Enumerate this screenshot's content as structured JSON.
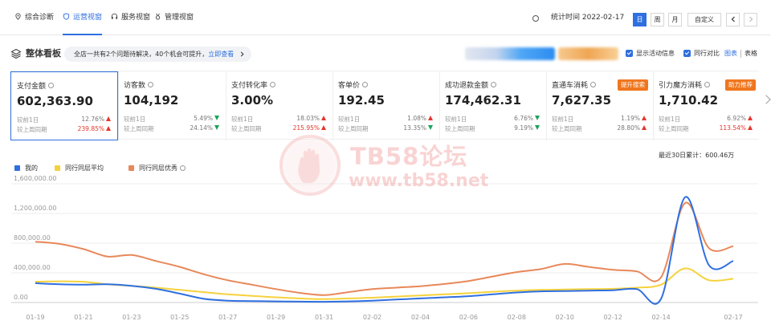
{
  "nav": {
    "tabs": [
      {
        "label": "综合诊断",
        "icon": "location-pin-icon"
      },
      {
        "label": "运营视窗",
        "icon": "shield-icon"
      },
      {
        "label": "服务视窗",
        "icon": "headset-icon"
      },
      {
        "label": "管理视窗",
        "icon": "medal-icon"
      }
    ],
    "active_tab": "运营视窗",
    "stat_time": "统计时间 2022-02-17",
    "period_buttons": [
      "日",
      "周",
      "月",
      "自定义"
    ],
    "active_period": "日",
    "prev_icon": "chevron-left-icon",
    "next_icon": "chevron-right-icon"
  },
  "board": {
    "title": "整体看板",
    "notice_text": "全店一共有2个问题待解决，40个机会可提升，",
    "notice_link": "立即查看",
    "show_activity_label": "显示活动信息",
    "peer_compare_label": "同行对比",
    "view_chart": "图表",
    "view_table": "表格"
  },
  "metrics": [
    {
      "label": "支付金额",
      "value": "602,363.90",
      "row1_label": "较前1日",
      "row1_pct": "12.76%",
      "row1_dir": "up",
      "row2_label": "较上周同期",
      "row2_pct": "239.85%",
      "row2_dir": "up",
      "selected": true
    },
    {
      "label": "访客数",
      "value": "104,192",
      "row1_label": "较前1日",
      "row1_pct": "5.49%",
      "row1_dir": "down",
      "row2_label": "较上周同期",
      "row2_pct": "24.14%",
      "row2_dir": "down"
    },
    {
      "label": "支付转化率",
      "value": "3.00%",
      "row1_label": "较前1日",
      "row1_pct": "18.03%",
      "row1_dir": "up",
      "row2_label": "较上周同期",
      "row2_pct": "215.95%",
      "row2_dir": "up"
    },
    {
      "label": "客单价",
      "value": "192.45",
      "row1_label": "较前1日",
      "row1_pct": "1.08%",
      "row1_dir": "up",
      "row2_label": "较上周同期",
      "row2_pct": "13.35%",
      "row2_dir": "down"
    },
    {
      "label": "成功退款金额",
      "value": "174,462.31",
      "row1_label": "较前1日",
      "row1_pct": "6.76%",
      "row1_dir": "down",
      "row2_label": "较上周同期",
      "row2_pct": "9.19%",
      "row2_dir": "down"
    },
    {
      "label": "直通车消耗",
      "value": "7,627.35",
      "row1_label": "较前1日",
      "row1_pct": "1.19%",
      "row1_dir": "up",
      "row2_label": "较上周同期",
      "row2_pct": "28.80%",
      "row2_dir": "up",
      "tag": "提升搜索"
    },
    {
      "label": "引力魔方消耗",
      "value": "1,710.42",
      "row1_label": "较前1日",
      "row1_pct": "6.92%",
      "row1_dir": "up",
      "row2_label": "较上周同期",
      "row2_pct": "113.54%",
      "row2_dir": "up",
      "tag": "助力推荐"
    }
  ],
  "cumulative_label": "最近30日累计：600.46万",
  "watermark": {
    "line1": "TB58论坛",
    "line2": "www.tb58.net"
  },
  "colors": {
    "accent": "#2f6fe0",
    "mine": "#2f6fe0",
    "peer_avg": "#f5d23c",
    "peer_top": "#e8885a",
    "up": "#e5352b",
    "down": "#1aa35a",
    "tag": "#f0761e"
  },
  "chart_data": {
    "type": "line",
    "ylim": [
      0,
      1600000
    ],
    "y_ticks": [
      "0.00",
      "400,000.00",
      "800,000.00",
      "1,200,000.00",
      "1,600,000.00"
    ],
    "x_tick_labels": [
      "01-19",
      "01-21",
      "01-23",
      "01-25",
      "01-27",
      "01-29",
      "01-31",
      "02-02",
      "02-04",
      "02-06",
      "02-08",
      "02-10",
      "02-12",
      "02-14",
      "02-17"
    ],
    "x_tick_index": [
      0,
      2,
      4,
      6,
      8,
      10,
      12,
      14,
      16,
      18,
      20,
      22,
      24,
      26,
      29
    ],
    "legend_position": "top-left",
    "grid": true,
    "x": [
      "01-19",
      "01-20",
      "01-21",
      "01-22",
      "01-23",
      "01-24",
      "01-25",
      "01-26",
      "01-27",
      "01-28",
      "01-29",
      "01-30",
      "01-31",
      "02-01",
      "02-02",
      "02-03",
      "02-04",
      "02-05",
      "02-06",
      "02-07",
      "02-08",
      "02-09",
      "02-10",
      "02-11",
      "02-12",
      "02-13",
      "02-14",
      "02-15",
      "02-16",
      "02-17"
    ],
    "series": [
      {
        "name": "我的",
        "color": "#2f6fe0",
        "values": [
          260000,
          245000,
          240000,
          245000,
          225000,
          185000,
          120000,
          50000,
          25000,
          20000,
          15000,
          12000,
          10000,
          15000,
          25000,
          40000,
          55000,
          70000,
          85000,
          110000,
          135000,
          150000,
          155000,
          160000,
          165000,
          180000,
          50000,
          1420000,
          500000,
          560000
        ]
      },
      {
        "name": "同行同层平均",
        "color": "#f5d23c",
        "values": [
          280000,
          285000,
          280000,
          245000,
          225000,
          200000,
          170000,
          140000,
          110000,
          90000,
          70000,
          55000,
          45000,
          55000,
          65000,
          80000,
          95000,
          110000,
          125000,
          145000,
          160000,
          170000,
          175000,
          180000,
          185000,
          200000,
          240000,
          460000,
          300000,
          320000
        ]
      },
      {
        "name": "同行同层优秀",
        "color": "#e8885a",
        "values": [
          820000,
          790000,
          720000,
          620000,
          640000,
          560000,
          480000,
          380000,
          300000,
          240000,
          180000,
          130000,
          100000,
          140000,
          180000,
          200000,
          220000,
          250000,
          290000,
          350000,
          410000,
          450000,
          520000,
          480000,
          440000,
          420000,
          340000,
          1340000,
          730000,
          760000
        ]
      }
    ]
  }
}
